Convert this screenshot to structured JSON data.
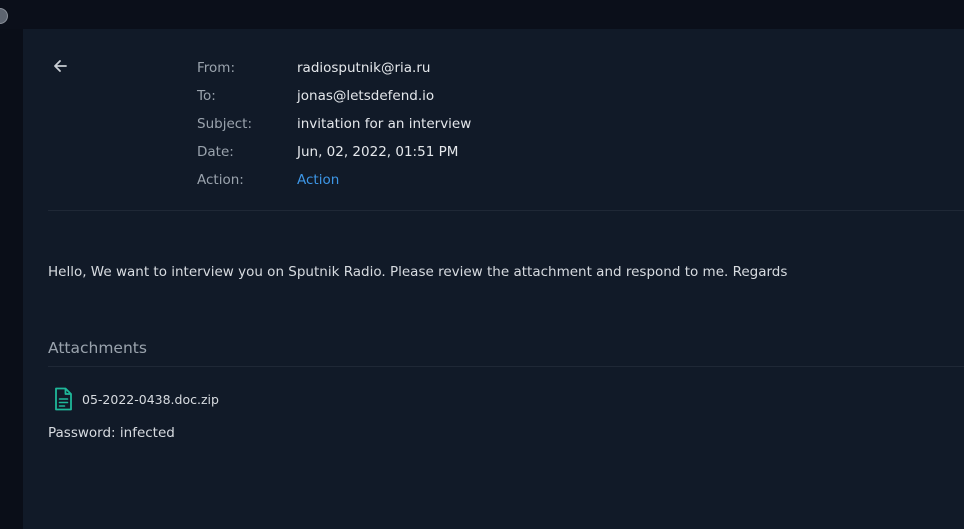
{
  "email": {
    "headers": [
      {
        "label": "From:",
        "value": "radiosputnik@ria.ru"
      },
      {
        "label": "To:",
        "value": "jonas@letsdefend.io"
      },
      {
        "label": "Subject:",
        "value": "invitation for an interview"
      },
      {
        "label": "Date:",
        "value": "Jun, 02, 2022, 01:51 PM"
      },
      {
        "label": "Action:",
        "value": "Action"
      }
    ],
    "body": "Hello, We want to interview you on Sputnik Radio. Please review the attachment and respond to me. Regards",
    "attachments_title": "Attachments",
    "attachments": [
      {
        "name": "05-2022-0438.doc.zip",
        "icon": "file-icon"
      }
    ],
    "password_note": "Password: infected"
  },
  "colors": {
    "panel_bg": "#111a28",
    "page_bg": "#0a0e18",
    "link": "#3d96e6",
    "attachment_icon": "#1fb89a"
  },
  "icons": {
    "back": "arrow-left-icon",
    "attachment": "file-icon"
  }
}
